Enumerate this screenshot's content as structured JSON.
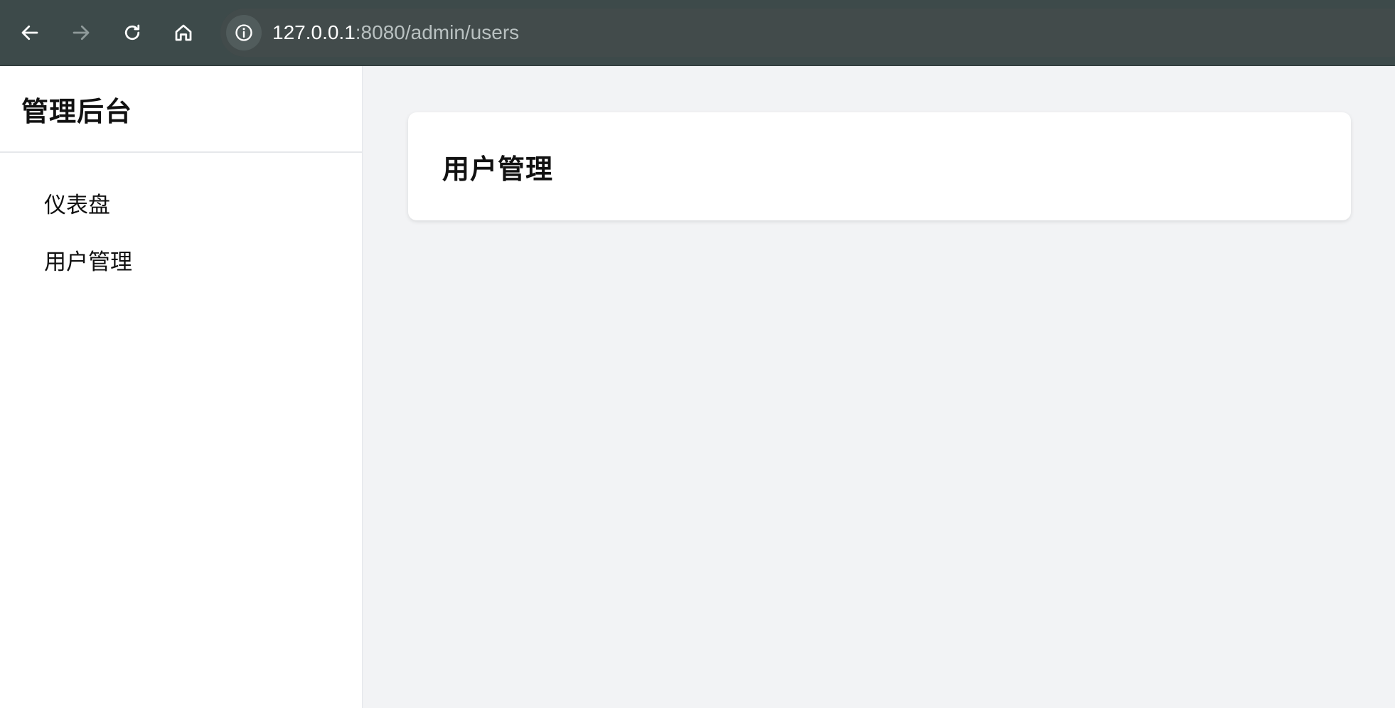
{
  "browser": {
    "url_host": "127.0.0.1",
    "url_path": ":8080/admin/users",
    "icons": {
      "back": "arrow-left-icon",
      "forward": "arrow-right-icon",
      "reload": "reload-icon",
      "home": "home-icon",
      "site_info": "info-icon"
    }
  },
  "sidebar": {
    "title": "管理后台",
    "items": [
      {
        "label": "仪表盘"
      },
      {
        "label": "用户管理"
      }
    ]
  },
  "main": {
    "card_title": "用户管理"
  },
  "colors": {
    "toolbar_bg": "#3d4a4a",
    "omnibox_bg": "#424b4b",
    "page_bg": "#f2f3f5",
    "sidebar_bg": "#ffffff",
    "text": "#111111"
  }
}
